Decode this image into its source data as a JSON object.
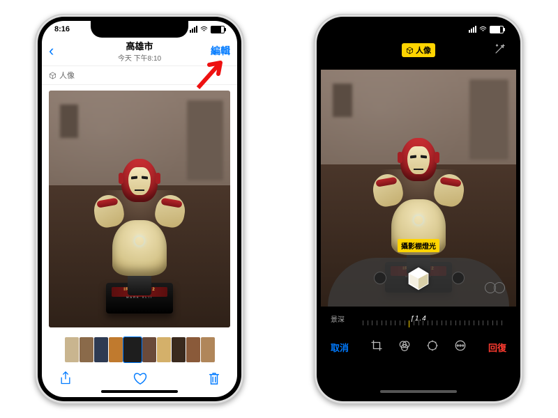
{
  "left": {
    "status_time": "8:16",
    "nav_title": "高雄市",
    "nav_subtitle": "今天 下午8:10",
    "edit_label": "編輯",
    "portrait_tag": "人像",
    "base_label": "IRON MAN 2",
    "base_sublabel": "MARK XLII",
    "thumb_colors": [
      "#c9b58f",
      "#8a6a4a",
      "#2e3a52",
      "#c07a2e",
      "#1e1e1e",
      "#6a4a3a",
      "#d4b06a",
      "#3a2a1e",
      "#8a5a3a",
      "#b0865a"
    ],
    "toolbar": {
      "share": "share",
      "favorite": "heart",
      "trash": "trash"
    }
  },
  "right": {
    "portrait_badge": "人像",
    "lighting_badge": "攝影棚燈光",
    "depth_label": "景深",
    "aperture_label": "ƒ1.4",
    "cancel_label": "取消",
    "revert_label": "回復",
    "edit_tools": [
      "crop",
      "filters",
      "adjust",
      "more"
    ]
  }
}
